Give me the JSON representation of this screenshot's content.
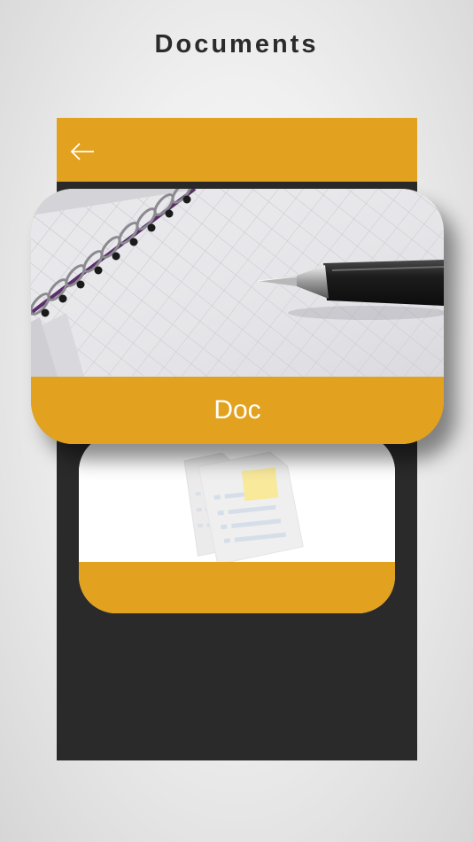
{
  "page": {
    "title": "Documents"
  },
  "appbar": {
    "back_icon": "arrow-left-icon",
    "color": "#e2a11f"
  },
  "cards": [
    {
      "label": "Doc",
      "image": "notebook-and-pen-photo"
    },
    {
      "label": "",
      "image": "document-illustration-icon"
    }
  ],
  "colors": {
    "accent": "#e2a11f",
    "panel": "#2a2a2a",
    "background": "#efefef"
  }
}
